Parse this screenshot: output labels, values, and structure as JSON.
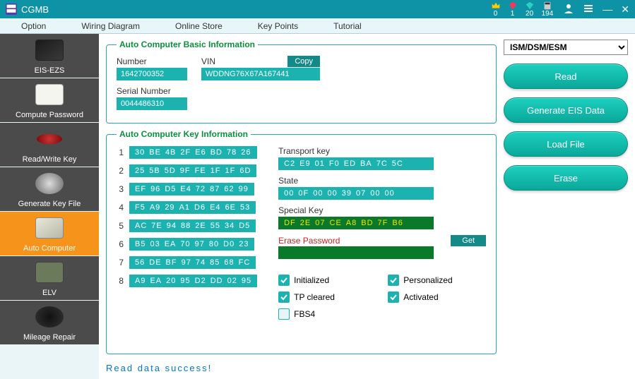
{
  "titlebar": {
    "app_name": "CGMB",
    "crown_count": "0",
    "diamond_red": "1",
    "diamond_teal": "20",
    "calc_count": "194"
  },
  "menus": [
    "Option",
    "Wiring Diagram",
    "Online Store",
    "Key Points",
    "Tutorial"
  ],
  "sidebar": {
    "items": [
      {
        "label": "EIS-EZS"
      },
      {
        "label": "Compute Password"
      },
      {
        "label": "Read/Write Key"
      },
      {
        "label": "Generate Key File"
      },
      {
        "label": "Auto Computer"
      },
      {
        "label": "ELV"
      },
      {
        "label": "Mileage Repair"
      }
    ]
  },
  "basic": {
    "legend": "Auto Computer Basic Information",
    "number_label": "Number",
    "number_value": "1642700352",
    "vin_label": "VIN",
    "vin_value": "WDDNG76X67A167441",
    "copy_label": "Copy",
    "serial_label": "Serial Number",
    "serial_value": "0044486310"
  },
  "keyinfo": {
    "legend": "Auto Computer Key Information",
    "keys": [
      "30 BE 4B 2F E6 BD 78 26",
      "25 5B 5D 9F FE 1F 1F 6D",
      "EF 96 D5 E4 72 87 62 99",
      "F5 A9 29 A1 D6 E4 6E 53",
      "AC 7E 94 88 2E 55 34 D5",
      "B5 03 EA 70 97 80 D0 23",
      "56 DE BF 97 74 85 68 FC",
      "A9 EA 20 95 D2 DD 02 95"
    ],
    "transport_label": "Transport key",
    "transport_value": "C2 E9 01 F0 ED BA 7C 5C",
    "state_label": "State",
    "state_value": "00 0F 00 00 39 07 00 00",
    "special_label": "Special Key",
    "special_value": "DF 2E 07 CE A8 BD 7F B6",
    "erase_label": "Erase Password",
    "get_label": "Get",
    "checks": {
      "initialized": "Initialized",
      "personalized": "Personalized",
      "tp_cleared": "TP cleared",
      "activated": "Activated",
      "fbs4": "FBS4"
    }
  },
  "status": "Read data success!",
  "right": {
    "selector_value": "ISM/DSM/ESM",
    "read": "Read",
    "gen": "Generate EIS Data",
    "load": "Load File",
    "erase": "Erase"
  }
}
